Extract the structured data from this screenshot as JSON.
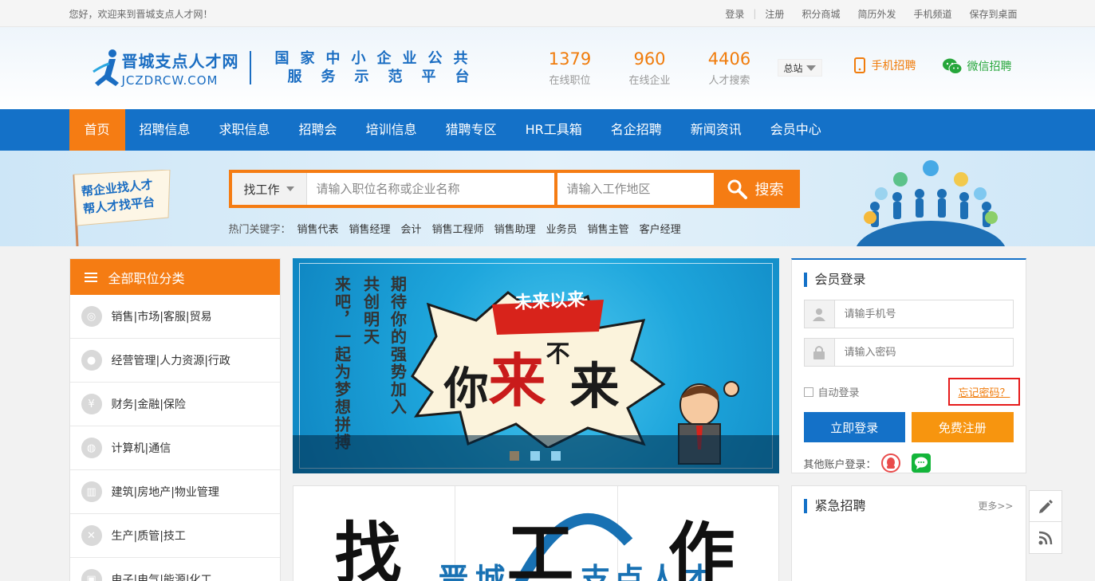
{
  "topbar": {
    "welcome": "您好，欢迎来到晋城支点人才网！",
    "links": [
      "登录",
      "注册",
      "积分商城",
      "简历外发",
      "手机频道",
      "保存到桌面"
    ]
  },
  "header": {
    "logo_cn": "晋城支点人才网",
    "logo_en": "JCZDRCW.COM",
    "slogan_line1": "国家中小企业公共",
    "slogan_line2": "服务示范平台",
    "stats": [
      {
        "num": "1379",
        "label": "在线职位"
      },
      {
        "num": "960",
        "label": "在线企业"
      },
      {
        "num": "4406",
        "label": "人才搜索"
      }
    ],
    "station": "总站",
    "mobile": "手机招聘",
    "wechat": "微信招聘"
  },
  "nav": {
    "items": [
      "首页",
      "招聘信息",
      "求职信息",
      "招聘会",
      "培训信息",
      "猎聘专区",
      "HR工具箱",
      "名企招聘",
      "新闻资讯",
      "会员中心"
    ]
  },
  "search": {
    "flag_line1": "帮企业找人才",
    "flag_line2": "帮人才找平台",
    "type": "找工作",
    "keyword_placeholder": "请输入职位名称或企业名称",
    "area_placeholder": "请输入工作地区",
    "button": "搜索",
    "hot_label": "热门关键字：",
    "hot_words": [
      "销售代表",
      "销售经理",
      "会计",
      "销售工程师",
      "销售助理",
      "业务员",
      "销售主管",
      "客户经理"
    ]
  },
  "category": {
    "title": "全部职位分类",
    "items": [
      "销售|市场|客服|贸易",
      "经营管理|人力资源|行政",
      "财务|金融|保险",
      "计算机|通信",
      "建筑|房地产|物业管理",
      "生产|质管|技工",
      "电子|电气|能源|化工"
    ]
  },
  "banner": {
    "col1": "期待你的强势加入",
    "col2": "共创明天",
    "col3": "来吧，一起为梦想拼搏",
    "badge": "未来以来",
    "headline_1": "你",
    "headline_2": "来",
    "headline_3": "不",
    "headline_4": "来",
    "dot_colors": [
      "#8a7b63",
      "#8fd0ee",
      "#8fd0ee"
    ]
  },
  "promo": {
    "text_1": "找",
    "text_2": "晋城",
    "text_3": "工",
    "text_4": "支点人才",
    "text_5": "作"
  },
  "login": {
    "title": "会员登录",
    "phone_placeholder": "请输手机号",
    "password_placeholder": "请输入密码",
    "remember": "自动登录",
    "forgot": "忘记密码？",
    "login_btn": "立即登录",
    "register_btn": "免费注册",
    "other": "其他账户登录："
  },
  "urgent": {
    "title": "紧急招聘",
    "more": "更多>>"
  },
  "colors": {
    "brand_blue": "#1471c8",
    "brand_orange": "#f57c13",
    "highlight_red": "#e61b1b"
  }
}
